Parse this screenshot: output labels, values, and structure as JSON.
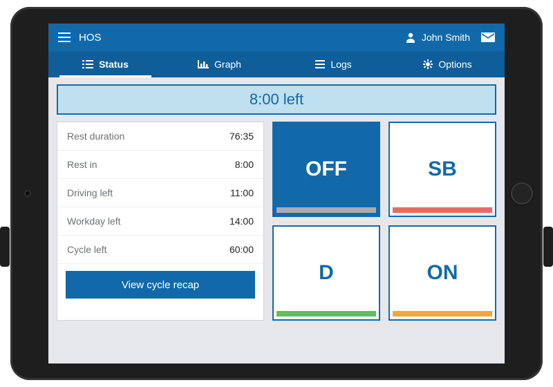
{
  "app": {
    "title": "HOS"
  },
  "user": {
    "name": "John Smith"
  },
  "tabs": [
    {
      "label": "Status",
      "icon": "list-icon",
      "active": true
    },
    {
      "label": "Graph",
      "icon": "graph-icon"
    },
    {
      "label": "Logs",
      "icon": "logs-icon"
    },
    {
      "label": "Options",
      "icon": "gear-icon"
    }
  ],
  "banner": {
    "text": "8:00 left"
  },
  "stats": [
    {
      "label": "Rest duration",
      "value": "76:35"
    },
    {
      "label": "Rest in",
      "value": "8:00"
    },
    {
      "label": "Driving left",
      "value": "11:00"
    },
    {
      "label": "Workday left",
      "value": "14:00"
    },
    {
      "label": "Cycle left",
      "value": "60:00"
    }
  ],
  "panel_button": "View cycle recap",
  "status_tiles": [
    {
      "code": "OFF",
      "stripe": "#a9acaf",
      "active": true
    },
    {
      "code": "SB",
      "stripe": "#e96a63"
    },
    {
      "code": "D",
      "stripe": "#5fbf5a"
    },
    {
      "code": "ON",
      "stripe": "#f3a63a"
    }
  ]
}
